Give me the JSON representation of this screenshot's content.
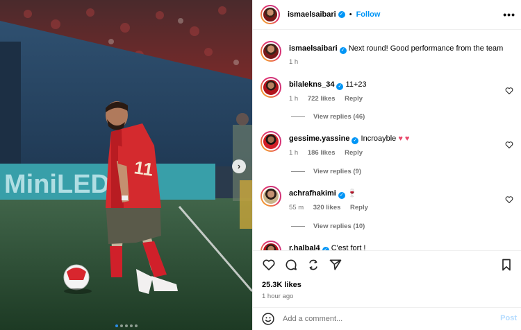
{
  "header": {
    "username": "ismaelsaibari",
    "separator": "•",
    "follow_label": "Follow",
    "more_label": "•••"
  },
  "caption": {
    "username": "ismaelsaibari",
    "text": "Next round! Good performance from the team",
    "time": "1 h"
  },
  "comments": [
    {
      "username": "bilalekns_34",
      "text": "11+23",
      "time": "1 h",
      "likes": "722 likes",
      "reply_label": "Reply",
      "view_replies": "View replies (46)"
    },
    {
      "username": "gessime.yassine",
      "text": "Incroayble",
      "emoji": "♥ ♥",
      "time": "1 h",
      "likes": "186 likes",
      "reply_label": "Reply",
      "view_replies": "View replies (9)"
    },
    {
      "username": "achrafhakimi",
      "text": "🍷",
      "time": "55 m",
      "likes": "320 likes",
      "reply_label": "Reply",
      "view_replies": "View replies (10)"
    },
    {
      "username": "r.halbal4",
      "text": "C'est fort !"
    }
  ],
  "photo": {
    "ad_board_text": "MiniLED",
    "jersey_number": "11",
    "carousel_total": 5,
    "carousel_active": 1
  },
  "engagement": {
    "likes": "25.3K likes",
    "time_ago": "1 hour ago"
  },
  "composer": {
    "placeholder": "Add a comment...",
    "post_label": "Post"
  },
  "icons": [
    "heart-icon",
    "comment-icon",
    "share-icon",
    "send-icon",
    "bookmark-icon",
    "emoji-icon",
    "more-icon",
    "next-arrow-icon"
  ],
  "colors": {
    "link": "#0095f6",
    "secondary_text": "#737373",
    "divider": "#efefef",
    "post_disabled": "#b3dbff"
  }
}
